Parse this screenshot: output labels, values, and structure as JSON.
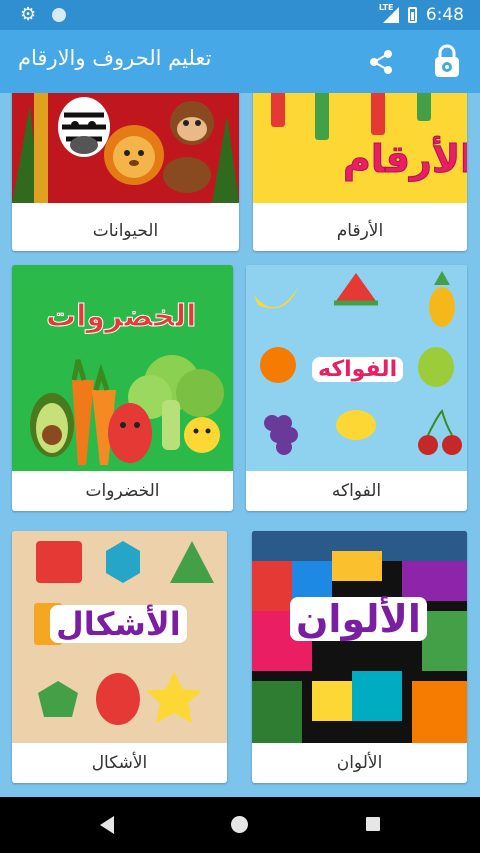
{
  "status_bar": {
    "settings_icon": "gear-icon",
    "network_label": "LTE",
    "time": "6:48"
  },
  "app_bar": {
    "title": "تعليم الحروف والارقام",
    "share_icon": "share-icon",
    "lock_icon": "lock-gear-icon"
  },
  "categories": [
    {
      "label": "الحيوانات",
      "art_text": ""
    },
    {
      "label": "الأرقام",
      "art_text": "الأرقام"
    },
    {
      "label": "الخضروات",
      "art_text": "الخضروات"
    },
    {
      "label": "الفواكه",
      "art_text": "الفواكه"
    },
    {
      "label": "الأشكال",
      "art_text": "الأشكال"
    },
    {
      "label": "الألوان",
      "art_text": "الألوان"
    }
  ],
  "colors": {
    "status_bar": "#2f8fd0",
    "app_bar": "#46a8e6",
    "background": "#7cc4ec"
  }
}
